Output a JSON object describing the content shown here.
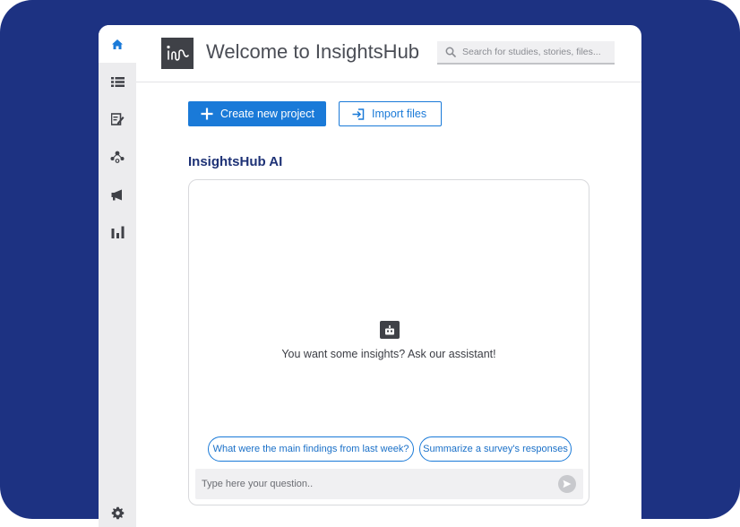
{
  "colors": {
    "background": "#1d3282",
    "accent": "#1a7ad8",
    "sidebar": "#ececee",
    "heading": "#1e3276"
  },
  "sidebar": {
    "items": [
      {
        "icon": "home-icon",
        "active": true
      },
      {
        "icon": "list-icon"
      },
      {
        "icon": "edit-note-icon"
      },
      {
        "icon": "network-icon"
      },
      {
        "icon": "megaphone-icon"
      },
      {
        "icon": "bar-chart-icon"
      },
      {
        "icon": "gear-icon"
      }
    ]
  },
  "header": {
    "title": "Welcome to InsightsHub",
    "search_placeholder": "Search for studies, stories, files..."
  },
  "actions": {
    "create_label": "Create new project",
    "import_label": "Import files"
  },
  "ai": {
    "section_title": "InsightsHub AI",
    "empty_message": "You want some insights? Ask our assistant!",
    "suggestions": [
      "What were the main findings from last week?",
      "Summarize a survey's responses"
    ],
    "input_placeholder": "Type here your question.."
  }
}
